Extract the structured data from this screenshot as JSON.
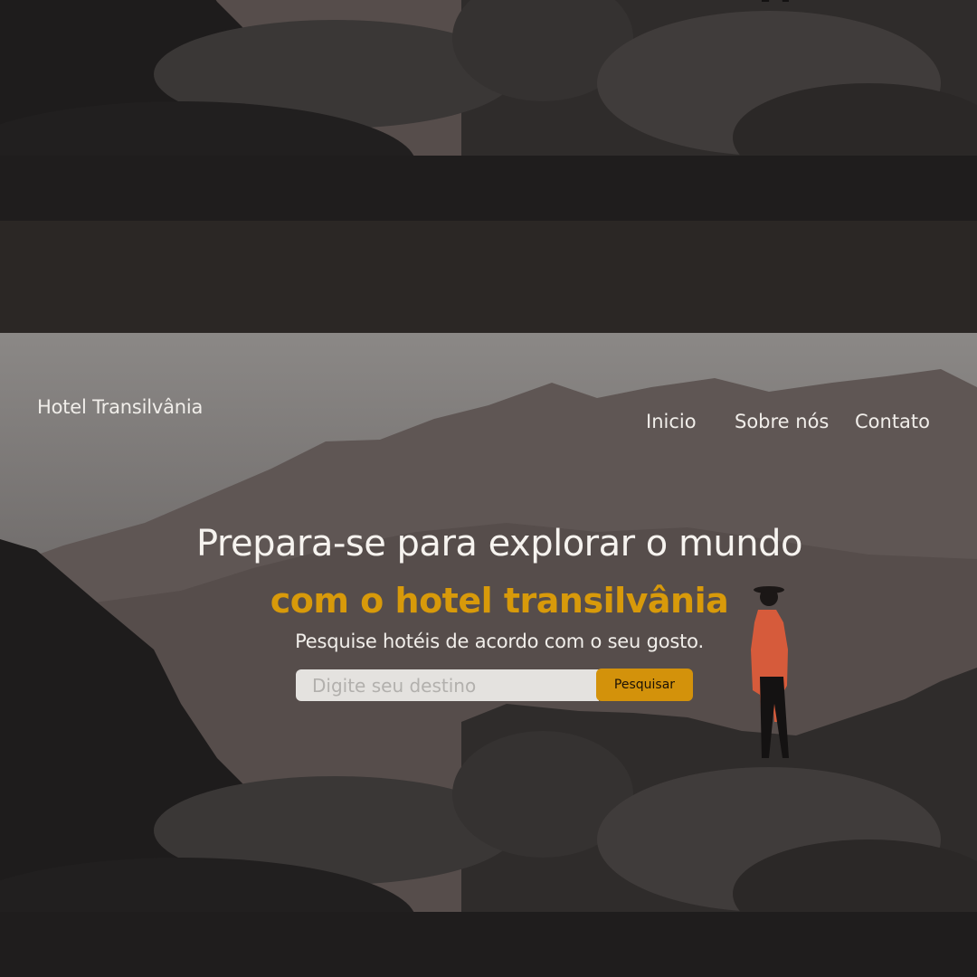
{
  "header": {
    "brand": "Hotel Transilvânia",
    "nav": [
      {
        "label": "Inicio"
      },
      {
        "label": "Sobre nós"
      },
      {
        "label": "Contato"
      }
    ]
  },
  "hero": {
    "headline": "Prepara-se para explorar o mundo",
    "subheadline": "com o hotel transilvânia",
    "tagline": "Pesquise hotéis de acordo com o seu gosto."
  },
  "search": {
    "placeholder": "Digite seu destino",
    "button_label": "Pesquisar"
  },
  "colors": {
    "accent": "#d89a0a",
    "button": "#d3920b",
    "text": "#f1eeea"
  }
}
